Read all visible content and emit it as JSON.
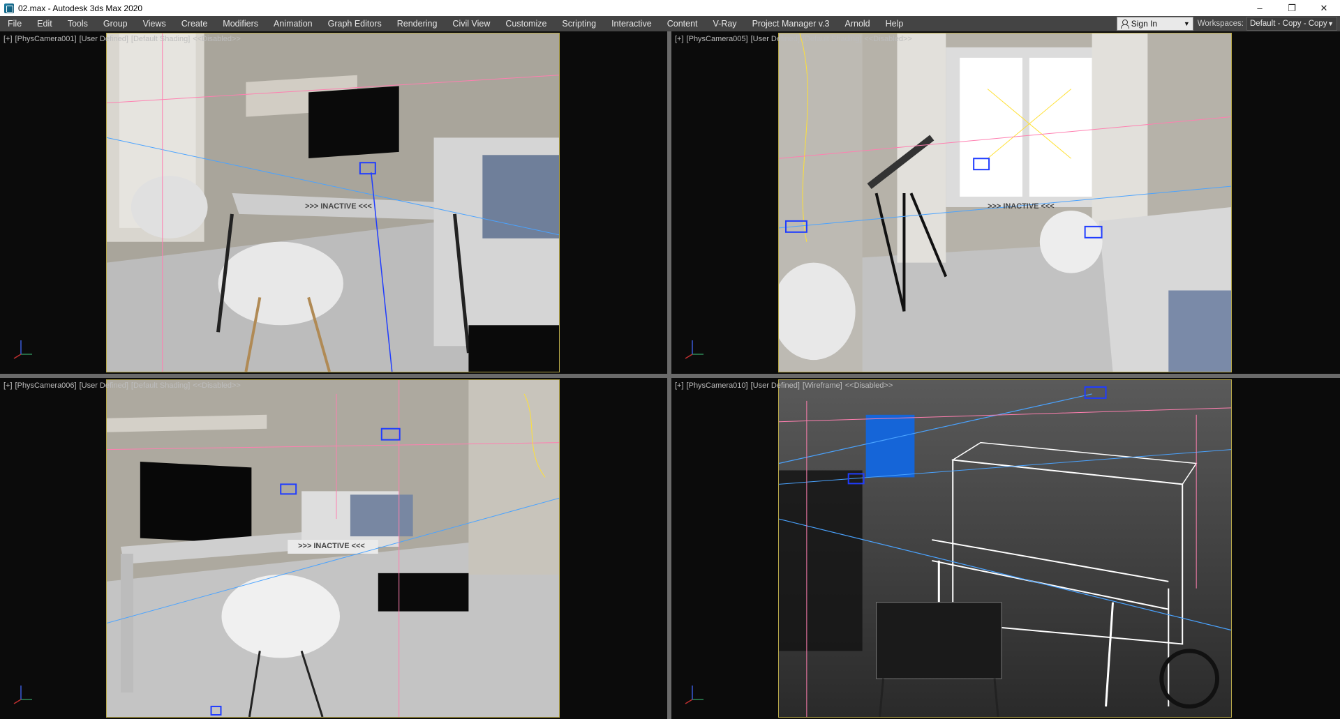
{
  "window": {
    "title": "02.max - Autodesk 3ds Max 2020",
    "controls": {
      "minimize": "–",
      "maximize": "❐",
      "close": "✕"
    }
  },
  "menu": {
    "items": [
      "File",
      "Edit",
      "Tools",
      "Group",
      "Views",
      "Create",
      "Modifiers",
      "Animation",
      "Graph Editors",
      "Rendering",
      "Civil View",
      "Customize",
      "Scripting",
      "Interactive",
      "Content",
      "V-Ray",
      "Project Manager v.3",
      "Arnold",
      "Help"
    ],
    "sign_in": "Sign In",
    "workspaces_label": "Workspaces:",
    "workspace_value": "Default - Copy - Copy"
  },
  "viewports": [
    {
      "plus": "[+]",
      "camera": "[PhysCamera001]",
      "view": "[User Defined]",
      "shading": "[Default Shading]",
      "state": "<<Disabled>>",
      "inactive": ">>> INACTIVE <<<"
    },
    {
      "plus": "[+]",
      "camera": "[PhysCamera005]",
      "view": "[User Defined]",
      "shading": "[Default Shading]",
      "state": "<<Disabled>>",
      "inactive": ">>> INACTIVE <<<"
    },
    {
      "plus": "[+]",
      "camera": "[PhysCamera006]",
      "view": "[User Defined]",
      "shading": "[Default Shading]",
      "state": "<<Disabled>>",
      "inactive": ">>> INACTIVE <<<"
    },
    {
      "plus": "[+]",
      "camera": "[PhysCamera010]",
      "view": "[User Defined]",
      "shading": "[Wireframe]",
      "state": "<<Disabled>>"
    }
  ],
  "colors": {
    "menu_bg": "#444444",
    "viewport_bg": "#0b0b0b",
    "safe_frame": "#b8a94a",
    "helper_pink": "#ff7fb0",
    "helper_blue": "#4aa3ff",
    "camera_blue": "#1f3cff"
  }
}
